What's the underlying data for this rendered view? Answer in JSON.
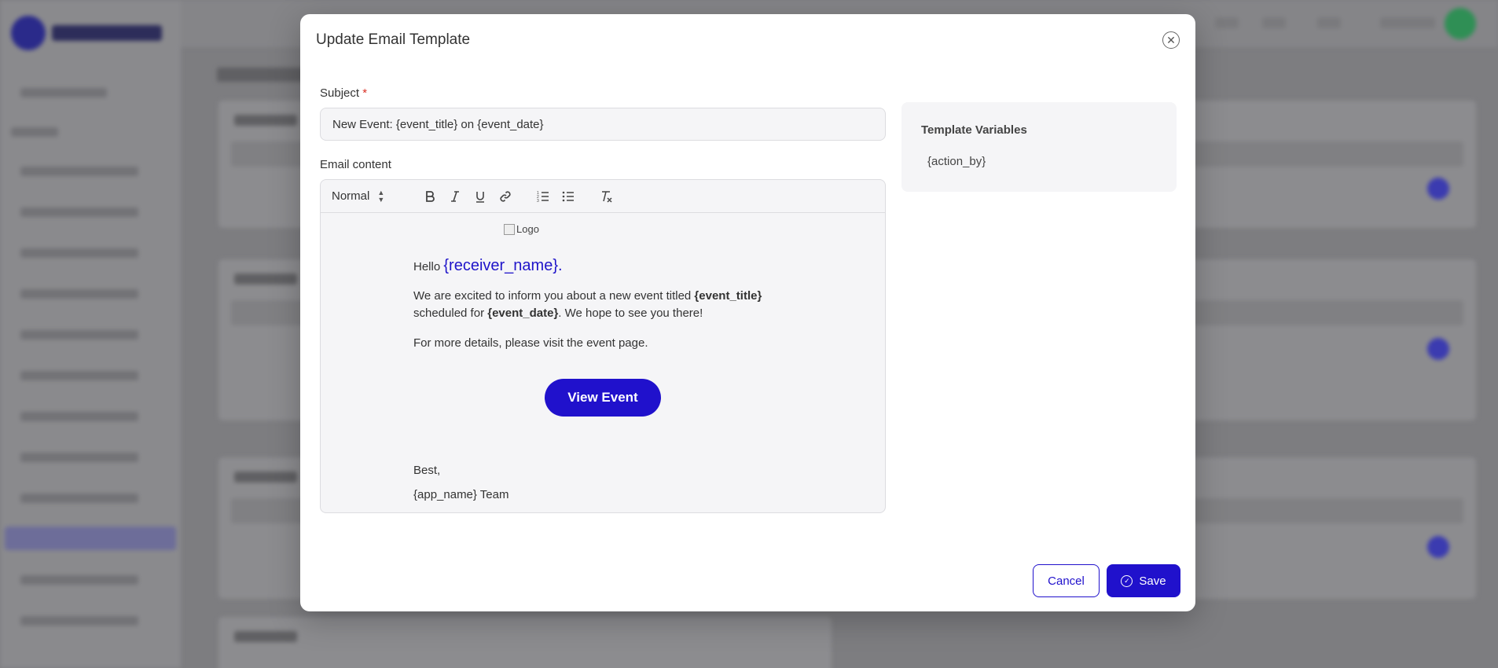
{
  "modal": {
    "title": "Update Email Template",
    "close_icon": "close-circle-icon"
  },
  "subject": {
    "label": "Subject",
    "required_mark": "*",
    "value": "New Event: {event_title} on {event_date}"
  },
  "email_content": {
    "label": "Email content",
    "toolbar": {
      "format_selected": "Normal",
      "buttons": [
        "bold-icon",
        "italic-icon",
        "underline-icon",
        "link-icon",
        "ordered-list-icon",
        "bullet-list-icon",
        "clear-format-icon"
      ]
    },
    "body": {
      "logo_alt": "Logo",
      "hello": "Hello",
      "receiver_var": "{receiver_name}",
      "hello_end": ".",
      "para1_a": "We are excited to inform you about a new event titled ",
      "para1_b": "{event_title}",
      "para1_c": " scheduled for ",
      "para1_d": "{event_date}",
      "para1_e": ". We hope to see you there!",
      "para2": "For more details, please visit the event page.",
      "button": "View Event",
      "sign_off": "Best,",
      "team": "{app_name} Team"
    }
  },
  "template_variables": {
    "title": "Template Variables",
    "items": [
      "{action_by}"
    ]
  },
  "footer": {
    "cancel": "Cancel",
    "save": "Save"
  },
  "colors": {
    "primary": "#2011cc",
    "required": "#d93025"
  }
}
